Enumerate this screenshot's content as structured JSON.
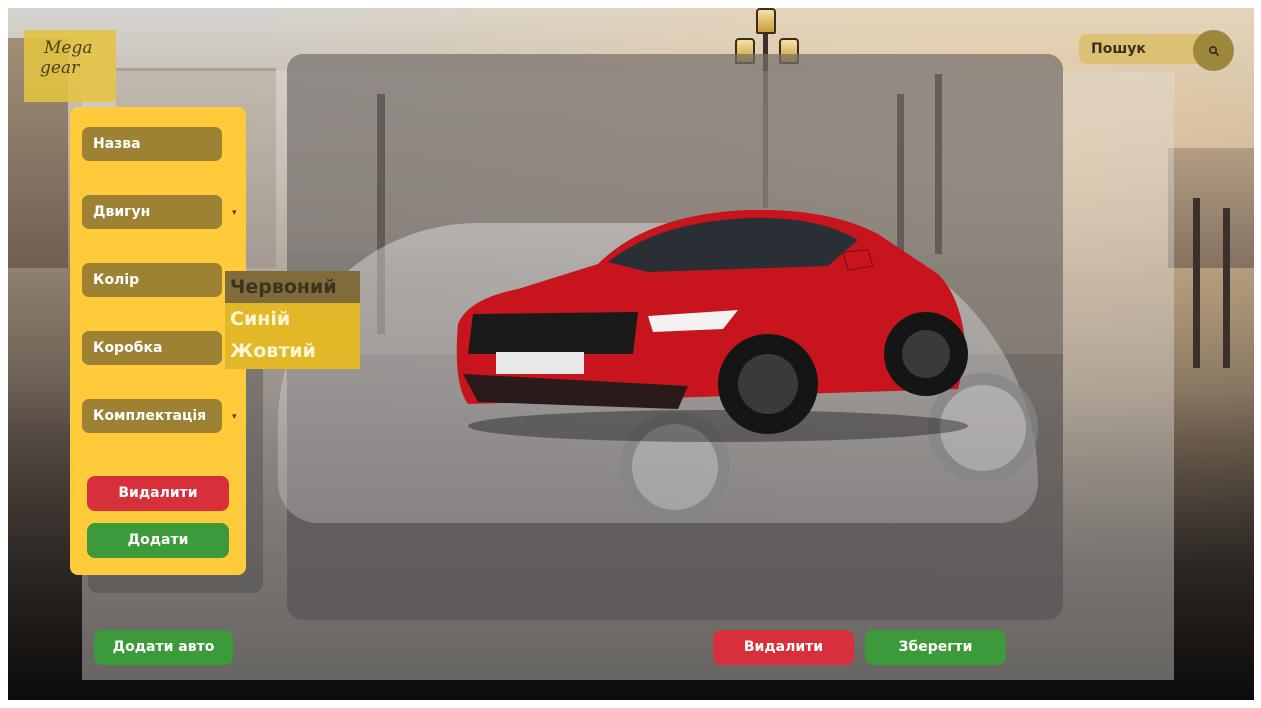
{
  "logo": {
    "line1": "Mega",
    "line2": "gear"
  },
  "search": {
    "placeholder": "Пошук"
  },
  "sidebar": {
    "fields": [
      {
        "label": "Назва"
      },
      {
        "label": "Двигун"
      },
      {
        "label": "Колір"
      },
      {
        "label": "Коробка"
      },
      {
        "label": "Комплектація"
      }
    ],
    "delete_label": "Видалити",
    "add_label": "Додати"
  },
  "color_dropdown": {
    "options": [
      "Червоний",
      "Синій",
      "Жовтий"
    ],
    "selected": "Червоний"
  },
  "footer": {
    "add_car_label": "Додати авто",
    "delete_label": "Видалити",
    "save_label": "Зберегти"
  },
  "colors": {
    "accent_yellow": "#ffcb3b",
    "field_brown": "#9e8233",
    "danger_red": "#d8303a",
    "success_green": "#3c9a3a",
    "car_red": "#c8141c"
  }
}
